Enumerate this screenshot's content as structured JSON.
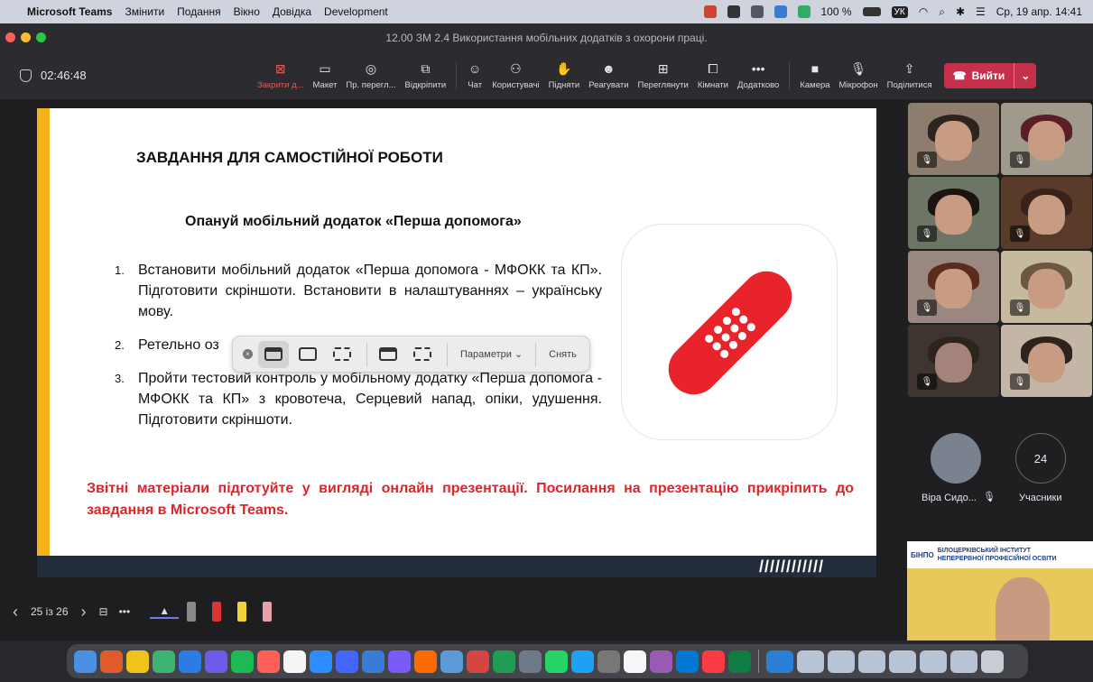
{
  "menubar": {
    "app": "Microsoft Teams",
    "items": [
      "Змінити",
      "Подання",
      "Вікно",
      "Довідка",
      "Development"
    ],
    "battery": "100 %",
    "lang": "УК",
    "datetime": "Ср, 19 апр.  14:41"
  },
  "window": {
    "title": "12.00 ЗМ 2.4 Використання мобільних додатків з охорони праці."
  },
  "toolbar": {
    "timer": "02:46:48",
    "buttons": [
      {
        "label": "Закрити д...",
        "icon": "close-share-icon",
        "glyph": "⊠",
        "red": true
      },
      {
        "label": "Макет",
        "icon": "layout-icon",
        "glyph": "▭"
      },
      {
        "label": "Пр. перегл...",
        "icon": "preview-icon",
        "glyph": "◎"
      },
      {
        "label": "Відкріпити",
        "icon": "popout-icon",
        "glyph": "⧉"
      }
    ],
    "buttons2": [
      {
        "label": "Чат",
        "icon": "chat-icon",
        "glyph": "☺"
      },
      {
        "label": "Користувачі",
        "icon": "people-icon",
        "glyph": "⚇"
      },
      {
        "label": "Підняти",
        "icon": "raise-hand-icon",
        "glyph": "✋"
      },
      {
        "label": "Реагувати",
        "icon": "react-icon",
        "glyph": "☻"
      },
      {
        "label": "Переглянути",
        "icon": "view-icon",
        "glyph": "⊞"
      },
      {
        "label": "Кімнати",
        "icon": "rooms-icon",
        "glyph": "⧠"
      },
      {
        "label": "Додатково",
        "icon": "more-icon",
        "glyph": "•••"
      }
    ],
    "buttons3": [
      {
        "label": "Камера",
        "icon": "camera-icon",
        "glyph": "■"
      },
      {
        "label": "Мікрофон",
        "icon": "microphone-icon",
        "glyph": "🎙"
      },
      {
        "label": "Поділитися",
        "icon": "share-icon",
        "glyph": "⇪"
      }
    ],
    "leave": "Вийти"
  },
  "slide": {
    "title": "ЗАВДАННЯ ДЛЯ САМОСТІЙНОЇ РОБОТИ",
    "subtitle": "Опануй мобільний додаток «Перша допомога»",
    "items": [
      {
        "num": "1.",
        "text": "Встановити мобільний додаток  «Перша допомога - МФОКК та КП». Підготовити скріншоти. Встановити в налаштуваннях – українську мову."
      },
      {
        "num": "2.",
        "text": "Ретельно оз                                                                а допомога - М"
      },
      {
        "num": "3.",
        "text": "Пройти тестовий контроль у мобільному додатку  «Перша допомога - МФОКК та КП» з кровотеча, Серцевий напад, опіки, удушення. Підготовити скріншоти."
      }
    ],
    "note": "Звітні матеріали підготуйте у вигляді онлайн презентації. Посилання на презентацію прикріпить до завдання в Microsoft Teams.",
    "stripes": "////////////"
  },
  "screenshot_bar": {
    "options": "Параметри",
    "capture": "Снять"
  },
  "slide_nav": {
    "counter": "25 із 26"
  },
  "participants": {
    "named": "Віра Сидо...",
    "count": "24",
    "count_label": "Учасники"
  },
  "selfview": {
    "banner_logo": "БІНПО",
    "banner_title": "БІЛОЦЕРКІВСЬКИЙ ІНСТИТУТ НЕПЕРЕРВНОЇ ПРОФЕСІЙНОЇ ОСВІТИ"
  }
}
